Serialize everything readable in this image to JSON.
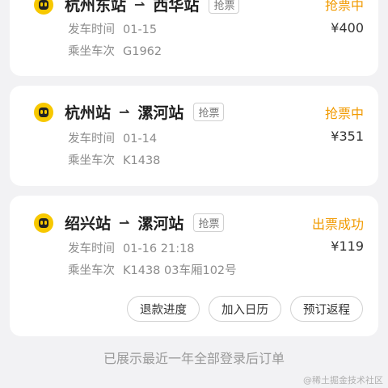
{
  "orders": [
    {
      "from": "杭州东站",
      "to": "西华站",
      "tag": "抢票",
      "status": "抢票中",
      "price": "¥400",
      "depart_label": "发车时间",
      "depart_value": "01-15",
      "train_label": "乘坐车次",
      "train_value": "G1962"
    },
    {
      "from": "杭州站",
      "to": "漯河站",
      "tag": "抢票",
      "status": "抢票中",
      "price": "¥351",
      "depart_label": "发车时间",
      "depart_value": "01-14",
      "train_label": "乘坐车次",
      "train_value": "K1438"
    },
    {
      "from": "绍兴站",
      "to": "漯河站",
      "tag": "抢票",
      "status": "出票成功",
      "price": "¥119",
      "depart_label": "发车时间",
      "depart_value": "01-16 21:18",
      "train_label": "乘坐车次",
      "train_value": "K1438 03车厢102号",
      "actions": [
        "退款进度",
        "加入日历",
        "预订返程"
      ]
    }
  ],
  "arrow": "⇀",
  "footer": "已展示最近一年全部登录后订单",
  "watermark": "@稀土掘金技术社区",
  "colors": {
    "accent": "#f19a00",
    "logo": "#f7c800",
    "background": "#f2f2f4"
  }
}
